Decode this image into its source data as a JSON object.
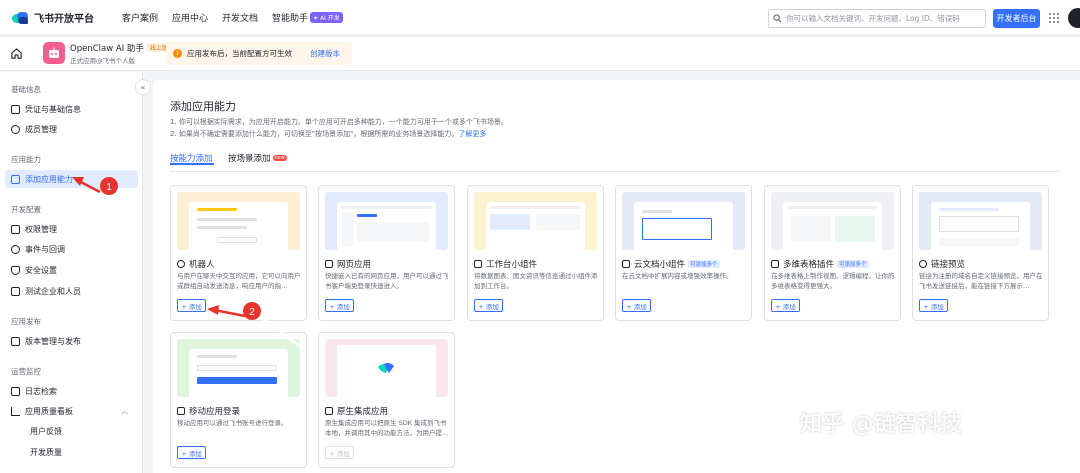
{
  "header": {
    "logo_text": "飞书开放平台",
    "nav": [
      "客户案例",
      "应用中心",
      "开发文档",
      "智能助手"
    ],
    "ai_badge": "✦ AI 开发",
    "search_placeholder": "你可以输入文档关键词、开发问题、Log ID、错误码",
    "dev_console_label": "开发者后台"
  },
  "app_bar": {
    "app_name": "OpenClaw AI 助手",
    "status_tag": "线上版",
    "app_subtitle": "正式应用@飞书个人版",
    "notice_text": "应用发布后，当前配置方可生效",
    "notice_link": "创建版本"
  },
  "sidebar": {
    "groups": [
      {
        "label": "基础信息",
        "items": [
          "凭证与基础信息",
          "成员管理"
        ]
      },
      {
        "label": "应用能力",
        "items": [
          "添加应用能力"
        ]
      },
      {
        "label": "开发配置",
        "items": [
          "权限管理",
          "事件与回调",
          "安全设置",
          "测试企业和人员"
        ]
      },
      {
        "label": "应用发布",
        "items": [
          "版本管理与发布"
        ]
      },
      {
        "label": "运营监控",
        "items": [
          "日志检索",
          "应用质量看板",
          "用户反馈",
          "开发质量"
        ]
      }
    ]
  },
  "main": {
    "title": "添加应用能力",
    "desc1": "1. 你可以根据实际需求，为应用开启能力。单个应用可开启多种能力，一个能力可用于一个或多个飞书场景。",
    "desc2": "2. 如果尚不确定需要添加什么能力，可切换至\"按场景添加\"，根据所需的业务场景选择能力。",
    "desc_link": "了解更多",
    "tabs": [
      "按能力添加",
      "按场景添加"
    ],
    "new_badge": "new",
    "add_label": "+ 添加",
    "cards": [
      {
        "title": "机器人",
        "tag": "",
        "desc": "与用户在聊天中交互的应用，它可以向用户或群组自动发送消息，响应用户的指…",
        "disabled": false
      },
      {
        "title": "网页应用",
        "tag": "",
        "desc": "快捷嵌入已有的网页应用，用户可以通过飞书客户端免登录快速进入。",
        "disabled": false
      },
      {
        "title": "工作台小组件",
        "tag": "",
        "desc": "将数据图表、图文资讯等信息通过小组件添加到工作台。",
        "disabled": false
      },
      {
        "title": "云文档小组件",
        "tag": "可添加多个",
        "desc": "在云文档中扩展内容或增强效率操作。",
        "disabled": false
      },
      {
        "title": "多维表格插件",
        "tag": "可添加多个",
        "desc": "在多维表格上制作视图、逻辑编程，让你的多维表格变得更强大。",
        "disabled": false
      },
      {
        "title": "链接预览",
        "tag": "",
        "desc": "链接为注册的域名自定义链接预览。用户在飞书发送链接后，能在链接下方展示…",
        "disabled": false
      },
      {
        "title": "移动应用登录",
        "tag": "",
        "desc": "移动应用可以通过飞书账号进行登录。",
        "disabled": false
      },
      {
        "title": "原生集成应用",
        "tag": "",
        "desc": "原生集成应用可以把原生 SDK 集成到飞书本地，并调用其中的功能方法，为用户提…",
        "disabled": true
      }
    ]
  },
  "annotations": {
    "step1": "1",
    "step2": "2"
  },
  "watermark": "知乎 @链智科技",
  "colors": {
    "primary": "#3370ff",
    "arrow": "#e8322d",
    "notice_bg": "#fff5eb"
  }
}
